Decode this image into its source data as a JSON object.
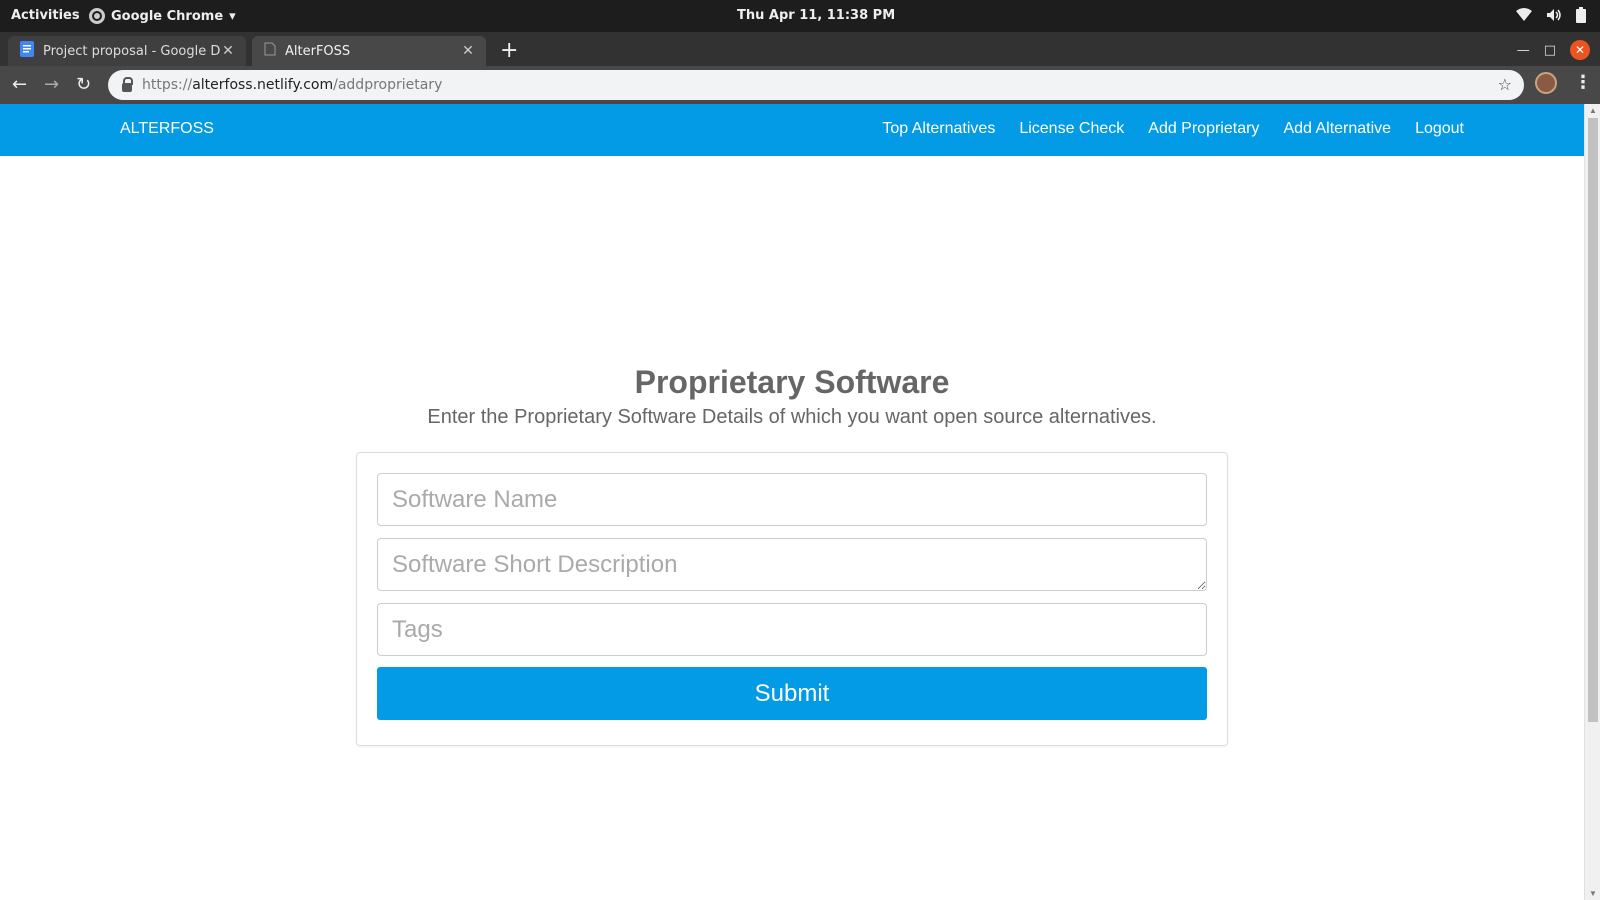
{
  "system": {
    "activities": "Activities",
    "app_name": "Google Chrome",
    "clock": "Thu Apr 11, 11:38 PM"
  },
  "browser": {
    "tabs": [
      {
        "title": "Project proposal - Google Do",
        "active": false
      },
      {
        "title": "AlterFOSS",
        "active": true
      }
    ],
    "url": {
      "scheme": "https://",
      "host": "alterfoss.netlify.com",
      "path": "/addproprietary"
    }
  },
  "site": {
    "brand": "ALTERFOSS",
    "nav": [
      "Top Alternatives",
      "License Check",
      "Add Proprietary",
      "Add Alternative",
      "Logout"
    ]
  },
  "main": {
    "title": "Proprietary Software",
    "subtitle": "Enter the Proprietary Software Details of which you want open source alternatives.",
    "form": {
      "software_name_placeholder": "Software Name",
      "description_placeholder": "Software Short Description",
      "tags_placeholder": "Tags",
      "submit_label": "Submit"
    }
  },
  "colors": {
    "primary": "#039be5",
    "heading": "#666666"
  }
}
